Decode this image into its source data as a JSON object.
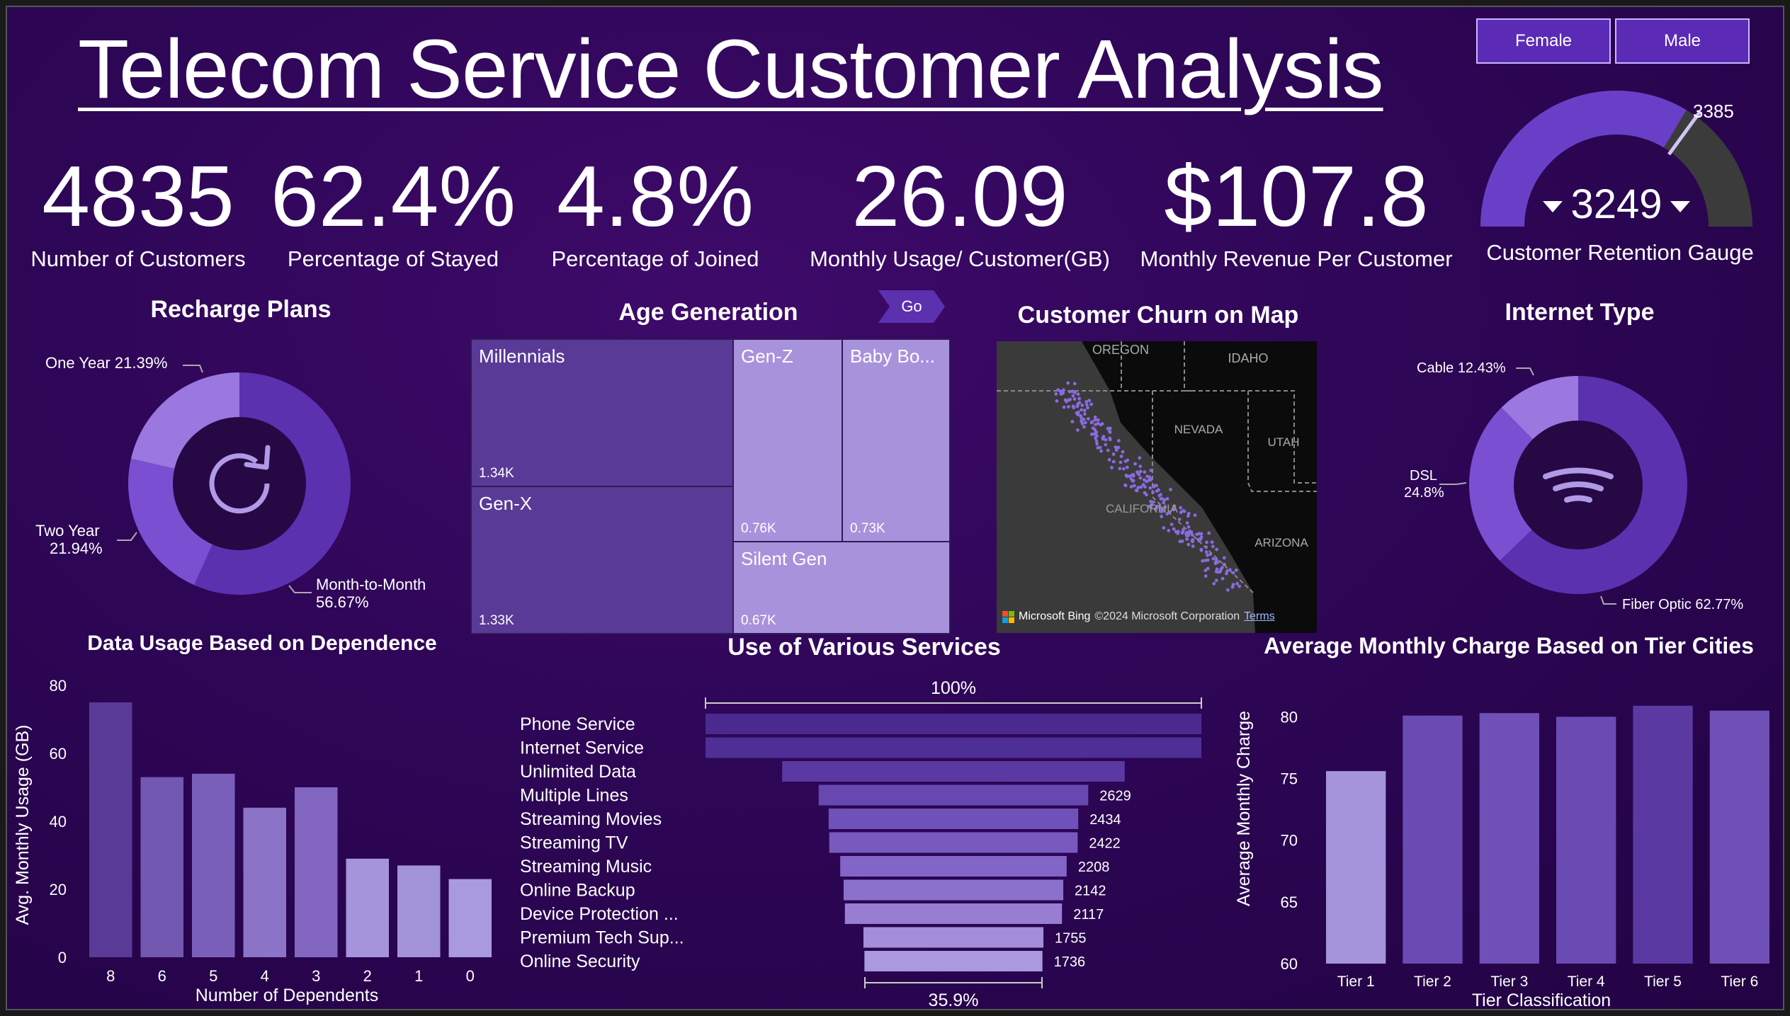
{
  "header": {
    "title": "Telecom Service Customer Analysis",
    "filters": [
      "Female",
      "Male"
    ]
  },
  "kpis": [
    {
      "value": "4835",
      "label": "Number of Customers"
    },
    {
      "value": "62.4%",
      "label": "Percentage of Stayed"
    },
    {
      "value": "4.8%",
      "label": "Percentage of Joined"
    },
    {
      "value": "26.09",
      "label": "Monthly Usage/ Customer(GB)"
    },
    {
      "value": "$107.8",
      "label": "Monthly Revenue Per Customer"
    }
  ],
  "gauge": {
    "value": 3249,
    "target": 3385,
    "value_label": "3249",
    "target_label": "3385",
    "label": "Customer Retention Gauge",
    "max": 4835
  },
  "recharge": {
    "title": "Recharge Plans",
    "slices": [
      {
        "name": "Month-to-Month",
        "pct": 56.67,
        "label_line1": "Month-to-Month",
        "label_line2": "56.67%",
        "color": "#5b31b0"
      },
      {
        "name": "Two Year",
        "pct": 21.94,
        "label_line1": "Two Year",
        "label_line2": "21.94%",
        "color": "#7a4fd1"
      },
      {
        "name": "One Year",
        "pct": 21.39,
        "label_line1": "One Year 21.39%",
        "label_line2": "",
        "color": "#9a78e0"
      }
    ],
    "icon": "refresh-icon"
  },
  "age": {
    "title": "Age Generation",
    "go_label": "Go",
    "cells": [
      {
        "name": "Millennials",
        "value": "1.34K",
        "color": "#5a3a97"
      },
      {
        "name": "Gen-X",
        "value": "1.33K",
        "color": "#5a3a97"
      },
      {
        "name": "Gen-Z",
        "value": "0.76K",
        "color": "#a892dc"
      },
      {
        "name": "Baby Bo...",
        "value": "0.73K",
        "color": "#a892dc"
      },
      {
        "name": "Silent Gen",
        "value": "0.67K",
        "color": "#a892dc"
      }
    ]
  },
  "map": {
    "title": "Customer Churn on Map",
    "states": [
      "OREGON",
      "IDAHO",
      "NEVADA",
      "UTAH",
      "CALIFORNIA",
      "ARIZONA"
    ],
    "brand": "Microsoft Bing",
    "copyright": "©2024 Microsoft Corporation",
    "terms": "Terms"
  },
  "internet": {
    "title": "Internet Type",
    "slices": [
      {
        "name": "Fiber Optic",
        "pct": 62.77,
        "label_line1": "Fiber Optic 62.77%",
        "label_line2": "",
        "color": "#5b31b0"
      },
      {
        "name": "DSL",
        "pct": 24.8,
        "label_line1": "DSL",
        "label_line2": "24.8%",
        "color": "#7a4fd1"
      },
      {
        "name": "Cable",
        "pct": 12.43,
        "label_line1": "Cable 12.43%",
        "label_line2": "",
        "color": "#9a78e0"
      }
    ],
    "icon": "wifi-icon"
  },
  "chart_data": [
    {
      "type": "bar",
      "title": "Data Usage Based on Dependence",
      "xlabel": "Number of Dependents",
      "ylabel": "Avg. Monthly Usage (GB)",
      "categories": [
        "8",
        "6",
        "5",
        "4",
        "3",
        "2",
        "1",
        "0"
      ],
      "values": [
        75,
        53,
        54,
        44,
        50,
        29,
        27,
        23
      ],
      "ylim": [
        0,
        80
      ],
      "yticks": [
        0,
        20,
        40,
        60,
        80
      ],
      "colors": [
        "#5a3a97",
        "#7258b0",
        "#7a5fba",
        "#8b73c7",
        "#8266c0",
        "#a594db",
        "#a292d8",
        "#a99ade"
      ]
    },
    {
      "type": "bar",
      "title": "Use of Various Services",
      "orientation": "funnel",
      "categories": [
        "Phone Service",
        "Internet Service",
        "Unlimited Data",
        "Multiple Lines",
        "Streaming Movies",
        "Streaming TV",
        "Streaming Music",
        "Online Backup",
        "Device Protection ...",
        "Premium Tech Sup...",
        "Online Security"
      ],
      "values": [
        4835,
        4835,
        3340,
        2629,
        2434,
        2422,
        2208,
        2142,
        2117,
        1755,
        1736
      ],
      "value_labels": [
        "",
        "",
        "",
        "2629",
        "2434",
        "2422",
        "2208",
        "2142",
        "2117",
        "1755",
        "1736"
      ],
      "top_label": "100%",
      "bottom_label": "35.9%",
      "colors": [
        "#4a2a8f",
        "#4e2f96",
        "#5a3aa2",
        "#6748b0",
        "#7051b9",
        "#7859bf",
        "#8265c6",
        "#8c71cc",
        "#977ed2",
        "#a38ed9",
        "#ab98de"
      ]
    },
    {
      "type": "bar",
      "title": "Average Monthly Charge Based on Tier Cities",
      "xlabel": "Tier Classification",
      "ylabel": "Average Monthly Charge",
      "categories": [
        "Tier 1",
        "Tier 2",
        "Tier 3",
        "Tier 4",
        "Tier 5",
        "Tier 6"
      ],
      "values": [
        75.6,
        80.1,
        80.3,
        80.0,
        80.9,
        80.5
      ],
      "ylim": [
        60,
        81
      ],
      "yticks": [
        60,
        65,
        70,
        75,
        80
      ],
      "colors": [
        "#a594db",
        "#6a4bb3",
        "#6e50b7",
        "#6a4bb3",
        "#5a3aa2",
        "#6e50b7"
      ]
    }
  ]
}
